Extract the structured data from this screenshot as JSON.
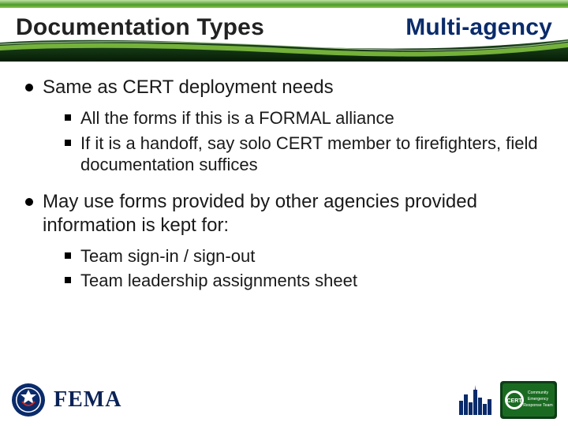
{
  "header": {
    "title_left": "Documentation Types",
    "title_right": "Multi-agency"
  },
  "content": {
    "bullets": [
      {
        "text": "Same as CERT deployment needs",
        "sub": [
          "All the forms if this is a FORMAL alliance",
          "If it is a handoff, say solo CERT member to firefighters, field documentation suffices"
        ]
      },
      {
        "text": "May use forms provided by other agencies provided information is kept for:",
        "sub": [
          "Team sign-in / sign-out",
          "Team leadership assignments sheet"
        ]
      }
    ]
  },
  "footer": {
    "dhs_seal_label": "DHS Seal",
    "fema_text": "FEMA",
    "cert_label": "CERT Community Emergency Response Team"
  },
  "colors": {
    "header_green_dark": "#0e3d14",
    "header_green_mid": "#1a6b21",
    "header_green_light": "#6fbf44",
    "accent_navy": "#0a2b6b"
  }
}
